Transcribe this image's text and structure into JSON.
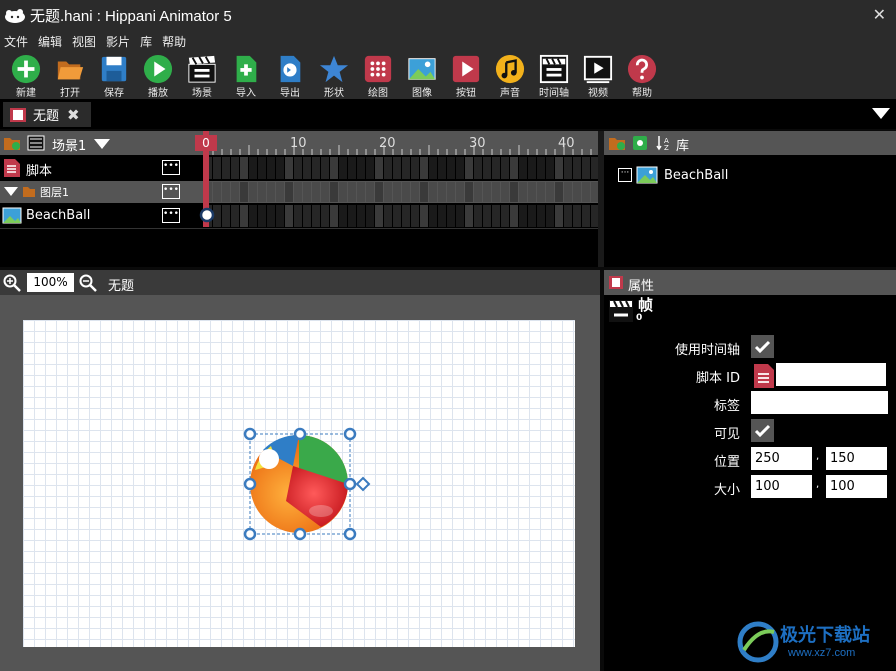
{
  "window": {
    "title": "无题.hani : Hippani Animator 5",
    "close": "✕"
  },
  "menu": [
    "文件",
    "编辑",
    "视图",
    "影片",
    "库",
    "帮助"
  ],
  "toolbar": [
    {
      "label": "新建",
      "icon": "new-icon"
    },
    {
      "label": "打开",
      "icon": "open-icon"
    },
    {
      "label": "保存",
      "icon": "save-icon"
    },
    {
      "label": "播放",
      "icon": "play-icon"
    },
    {
      "label": "场景",
      "icon": "scene-icon"
    },
    {
      "label": "导入",
      "icon": "import-icon"
    },
    {
      "label": "导出",
      "icon": "export-icon"
    },
    {
      "label": "形状",
      "icon": "shape-icon"
    },
    {
      "label": "绘图",
      "icon": "draw-icon"
    },
    {
      "label": "图像",
      "icon": "image-icon"
    },
    {
      "label": "按钮",
      "icon": "button-icon"
    },
    {
      "label": "声音",
      "icon": "sound-icon"
    },
    {
      "label": "时间轴",
      "icon": "timeline-icon"
    },
    {
      "label": "视频",
      "icon": "video-icon"
    },
    {
      "label": "帮助",
      "icon": "help-icon"
    }
  ],
  "doc_tab": {
    "label": "无题",
    "close": "✖"
  },
  "timeline": {
    "scene": "场景1",
    "ruler": [
      "0",
      "10",
      "20",
      "30",
      "40"
    ],
    "rows": [
      {
        "name": "脚本",
        "more": "•••"
      },
      {
        "name": "图层1",
        "more": "•••"
      },
      {
        "name": "BeachBall",
        "more": "•••"
      }
    ]
  },
  "library": {
    "title": "库",
    "item": "BeachBall",
    "expand": "···"
  },
  "stage": {
    "zoom": "100%",
    "title": "无题"
  },
  "properties": {
    "title": "属性",
    "section": "帧",
    "frame_number": "0",
    "use_timeline_label": "使用时间轴",
    "script_id_label": "脚本 ID",
    "tag_label": "标签",
    "visible_label": "可见",
    "position_label": "位置",
    "position_x": "250",
    "position_y": "150",
    "size_label": "大小",
    "size_x": "100",
    "size_y": "100",
    "comma": ","
  },
  "watermark": {
    "main": "极光下载站",
    "url": "www.xz7.com"
  },
  "colors": {
    "accent": "#c0394b",
    "panel": "#555555",
    "selection": "#3b7bbf"
  }
}
